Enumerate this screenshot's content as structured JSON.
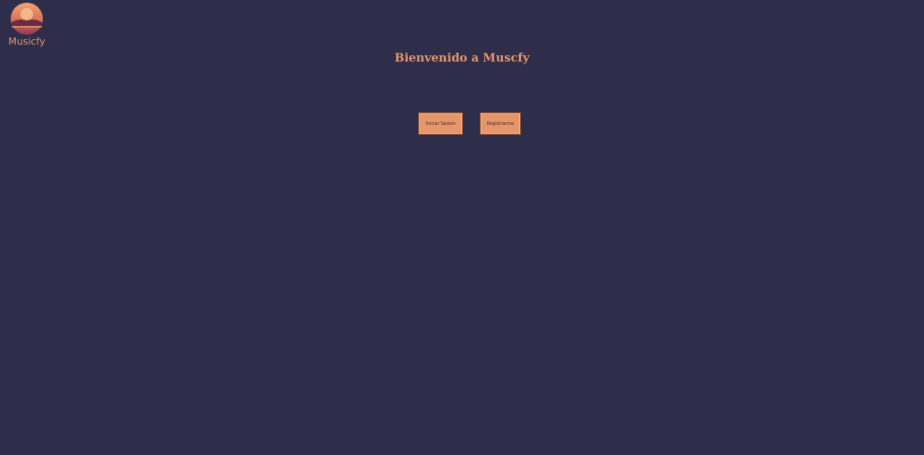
{
  "app": {
    "logo_text": "Musicfy",
    "title": "Bienvenido a Muscfy"
  },
  "actions": {
    "login_label": "Iniciar Sesion",
    "register_label": "Registrarme"
  },
  "colors": {
    "background": "#2e2d4a",
    "accent": "#e5966b"
  }
}
